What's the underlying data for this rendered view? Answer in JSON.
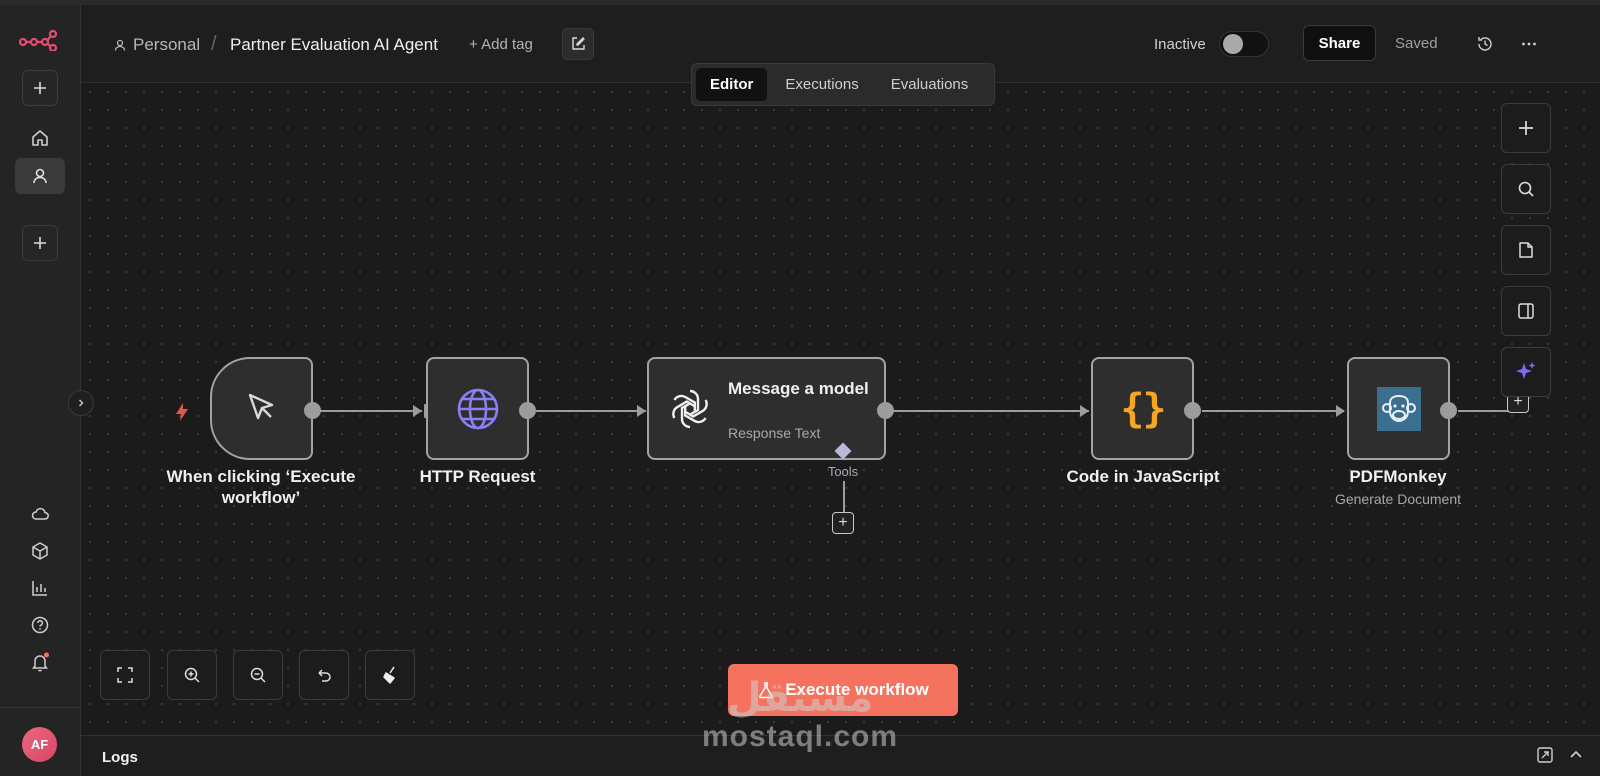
{
  "app": {
    "name": "n8n"
  },
  "breadcrumb": {
    "project": "Personal",
    "separator": "/",
    "workflow_title": "Partner Evaluation AI Agent",
    "add_tag": "+ Add tag"
  },
  "header": {
    "status_label": "Inactive",
    "active": false,
    "share_label": "Share",
    "saved_label": "Saved"
  },
  "tabs": [
    {
      "label": "Editor",
      "active": true
    },
    {
      "label": "Executions",
      "active": false
    },
    {
      "label": "Evaluations",
      "active": false
    }
  ],
  "sidebar": {
    "top_items": [
      "add-icon",
      "home-icon",
      "user-icon",
      "add-icon"
    ],
    "bottom_items": [
      "cloud-icon",
      "templates-icon",
      "insights-icon",
      "help-icon",
      "bell-icon"
    ],
    "avatar_initials": "AF"
  },
  "nodes": [
    {
      "id": "trigger",
      "label": "When clicking ‘Execute workflow’",
      "icon": "cursor-icon"
    },
    {
      "id": "http",
      "label": "HTTP Request",
      "icon": "globe-icon"
    },
    {
      "id": "openai",
      "label": "Message a model",
      "subtitle": "Response Text",
      "port_label": "Tools",
      "icon": "openai-icon"
    },
    {
      "id": "code",
      "label": "Code in JavaScript",
      "icon": "curly-braces-icon"
    },
    {
      "id": "pdf",
      "label": "PDFMonkey",
      "subtitle": "Generate Document",
      "icon": "monkey-icon"
    }
  ],
  "execute_button": {
    "label": "Execute workflow"
  },
  "logs": {
    "label": "Logs"
  },
  "watermark": {
    "logo": "مستقل",
    "text": "mostaql.com"
  },
  "colors": {
    "accent": "#f4725e",
    "logo": "#ea4b71",
    "code": "#f5a623",
    "http": "#8b7ff5",
    "ai_sparkle": "#7c6bf5",
    "pdfmonkey_bg": "#3b6f8f"
  }
}
